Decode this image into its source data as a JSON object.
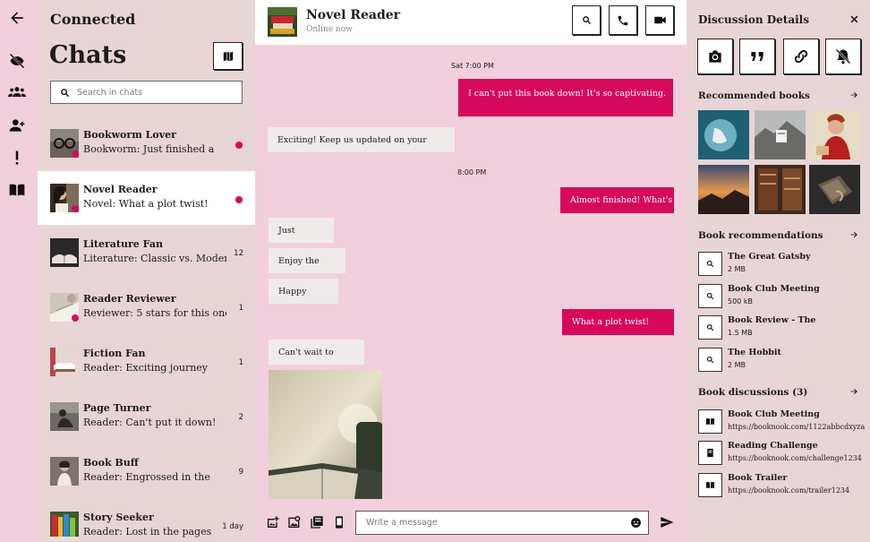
{
  "rail": {
    "icons": [
      "back-arrow-icon",
      "hidden-eye-icon",
      "group-icon",
      "add-person-icon",
      "alert-icon",
      "book-icon"
    ]
  },
  "list": {
    "brand": "Connected",
    "title": "Chats",
    "search_placeholder": "Search in chats",
    "items": [
      {
        "name": "Bookworm Lover",
        "preview": "Bookworm: Just finished a",
        "unread": true,
        "meta": ""
      },
      {
        "name": "Novel Reader",
        "preview": "Novel: What a plot twist!",
        "unread": true,
        "meta": "",
        "active": true
      },
      {
        "name": "Literature Fan",
        "preview": "Literature: Classic vs. Modern",
        "unread": false,
        "meta": "12"
      },
      {
        "name": "Reader Reviewer",
        "preview": "Reviewer: 5 stars for this one",
        "unread": false,
        "meta": "1"
      },
      {
        "name": "Fiction Fan",
        "preview": "Reader: Exciting journey",
        "unread": false,
        "meta": "1"
      },
      {
        "name": "Page Turner",
        "preview": "Reader: Can't put it down!",
        "unread": false,
        "meta": "2"
      },
      {
        "name": "Book Buff",
        "preview": "Reader: Engrossed in the",
        "unread": false,
        "meta": "9"
      },
      {
        "name": "Story Seeker",
        "preview": "Reader: Lost in the pages",
        "unread": false,
        "meta": "1 day"
      }
    ]
  },
  "conversation": {
    "title": "Novel Reader",
    "status": "Online now",
    "messages": [
      {
        "type": "stamp",
        "text": "Sat 7:00 PM"
      },
      {
        "type": "out",
        "text": "I can't put this book down! It's so captivating."
      },
      {
        "type": "in",
        "text": "Exciting! Keep us updated on your"
      },
      {
        "type": "stamp",
        "text": "8:00 PM"
      },
      {
        "type": "out",
        "text": "Almost finished! What's"
      },
      {
        "type": "in",
        "text": "Just"
      },
      {
        "type": "in",
        "text": "Enjoy the"
      },
      {
        "type": "in",
        "text": "Happy"
      },
      {
        "type": "out",
        "text": "What a plot twist!"
      },
      {
        "type": "in",
        "text": "Can't wait to"
      }
    ],
    "composer_placeholder": "Write a message"
  },
  "details": {
    "title": "Discussion Details",
    "sections": {
      "recommended_books": "Recommended books",
      "book_recommendations": "Book recommendations",
      "book_discussions": "Book discussions (3)"
    },
    "files": [
      {
        "title": "The Great Gatsby",
        "sub": "2 MB"
      },
      {
        "title": "Book Club Meeting",
        "sub": "500 kB"
      },
      {
        "title": "Book Review - The",
        "sub": "1.5 MB"
      },
      {
        "title": "The Hobbit",
        "sub": "2 MB"
      }
    ],
    "links": [
      {
        "title": "Book Club Meeting",
        "sub": "https://booknook.com/1122abbcdxyza"
      },
      {
        "title": "Reading Challenge",
        "sub": "https://booknook.com/challenge1234"
      },
      {
        "title": "Book Trailer",
        "sub": "https://booknook.com/trailer1234"
      }
    ]
  }
}
